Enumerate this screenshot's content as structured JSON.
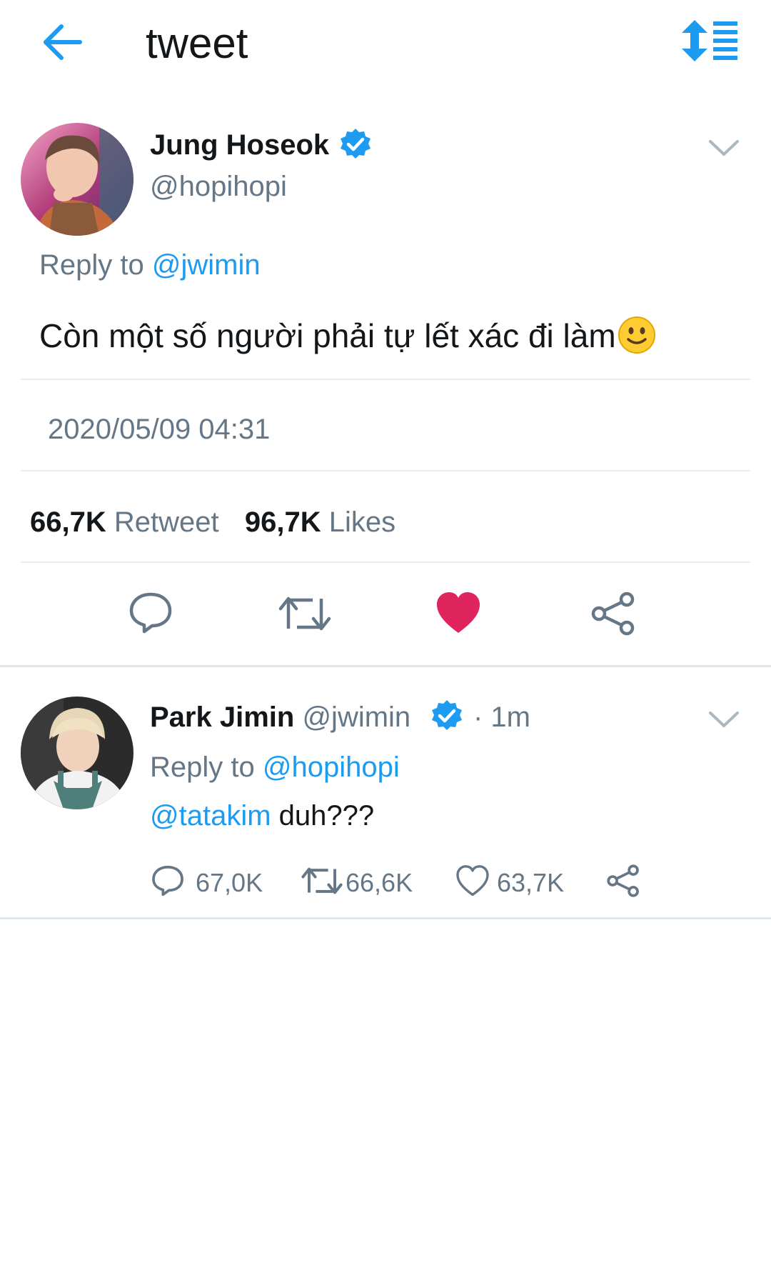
{
  "header": {
    "back_icon": "arrow-left-icon",
    "title": "tweet",
    "sort_icon": "sort-list-icon"
  },
  "colors": {
    "accent": "#1d9bf0",
    "like_red": "#e0245e",
    "secondary_text": "#657786",
    "divider": "#e6ecf0"
  },
  "main_tweet": {
    "author_name": "Jung Hoseok",
    "handle": "@hopihopi",
    "verified_icon": "verified-badge-icon",
    "reply_prefix": "Reply to",
    "reply_to": "@jwimin",
    "text": "Còn một số người phải tự lết xác đi làm",
    "emoji": "slightly-smiling-face-icon",
    "timestamp": "2020/05/09 04:31",
    "retweet_count": "66,7K",
    "retweet_label": "Retweet",
    "likes_count": "96,7K",
    "likes_label": "Likes",
    "liked": true
  },
  "reply_tweet": {
    "author_name": "Park Jimin",
    "handle": "@jwimin",
    "time": "· 1m",
    "reply_prefix": "Reply to",
    "reply_to": "@hopihopi",
    "mention": "@tatakim",
    "text": " duh???",
    "reply_count": "67,0K",
    "retweet_count": "66,6K",
    "like_count": "63,7K"
  }
}
